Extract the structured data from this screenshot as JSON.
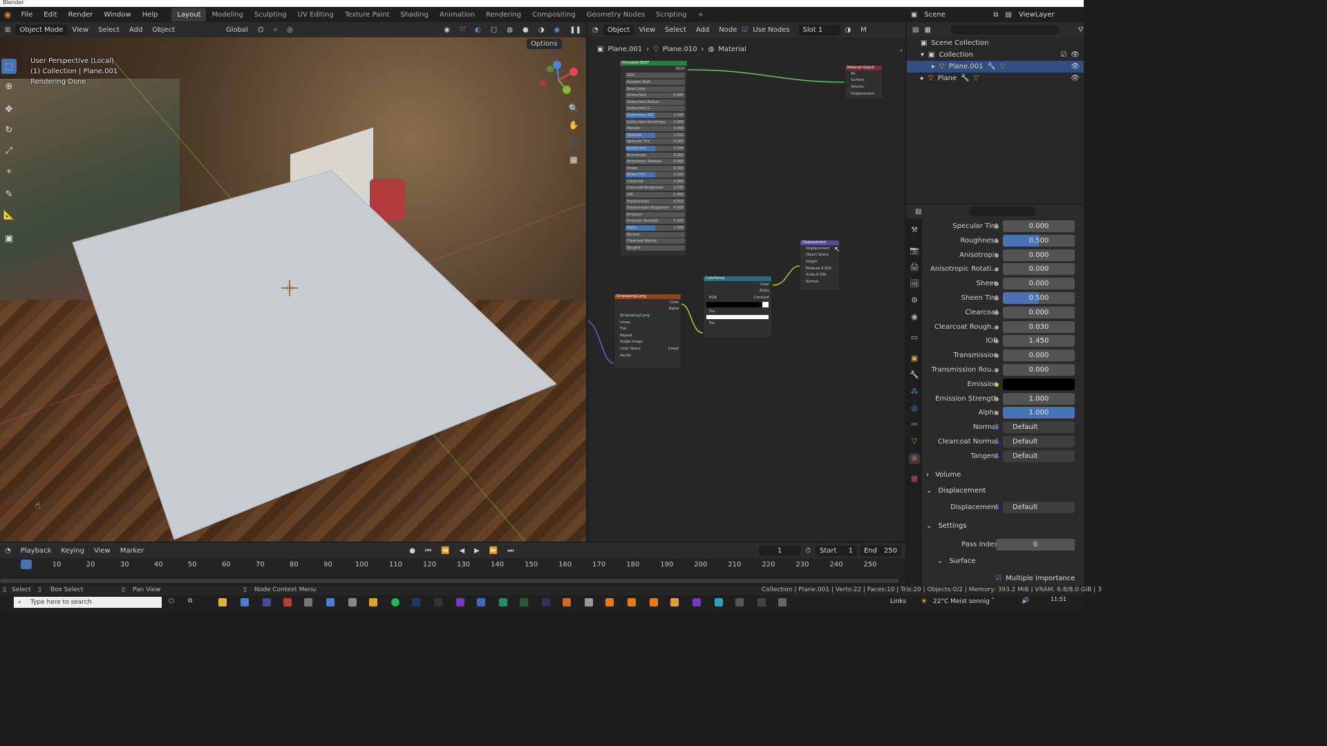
{
  "app_title": "Blender",
  "menu": [
    "File",
    "Edit",
    "Render",
    "Window",
    "Help"
  ],
  "workspaces": [
    "Layout",
    "Modeling",
    "Sculpting",
    "UV Editing",
    "Texture Paint",
    "Shading",
    "Animation",
    "Rendering",
    "Compositing",
    "Geometry Nodes",
    "Scripting"
  ],
  "active_workspace": "Layout",
  "scene": "Scene",
  "view_layer": "ViewLayer",
  "viewport_header": {
    "mode": "Object Mode",
    "menus": [
      "View",
      "Select",
      "Add",
      "Object"
    ],
    "transform": "Global",
    "options": "Options"
  },
  "viewport_info": {
    "line1": "User Perspective (Local)",
    "line2": "(1) Collection | Plane.001",
    "line3": "Rendering Done"
  },
  "node_header": {
    "type": "Object",
    "menus": [
      "View",
      "Select",
      "Add",
      "Node"
    ],
    "use_nodes": "Use Nodes",
    "slot": "Slot 1",
    "extra": "M"
  },
  "breadcrumb": [
    "Plane.001",
    "Plane.010",
    "Material"
  ],
  "nodes": {
    "bsdf": {
      "title": "Principled BSDF",
      "out": "BSDF",
      "rows": [
        {
          "label": "GGX",
          "value": ""
        },
        {
          "label": "Random Walk",
          "value": ""
        },
        {
          "label": "Base Color",
          "value": ""
        },
        {
          "label": "Subsurface",
          "value": "0.000"
        },
        {
          "label": "Subsurface Radius",
          "value": ""
        },
        {
          "label": "Subsurface C...",
          "value": ""
        },
        {
          "label": "Subsurface IOR",
          "value": "1.400"
        },
        {
          "label": "Subsurface Anisotropy",
          "value": "0.000"
        },
        {
          "label": "Metallic",
          "value": "0.000"
        },
        {
          "label": "Specular",
          "value": "0.500"
        },
        {
          "label": "Specular Tint",
          "value": "0.000"
        },
        {
          "label": "Roughness",
          "value": "0.500"
        },
        {
          "label": "Anisotropic",
          "value": "0.000"
        },
        {
          "label": "Anisotropic Rotation",
          "value": "0.000"
        },
        {
          "label": "Sheen",
          "value": "0.000"
        },
        {
          "label": "Sheen Tint",
          "value": "0.500"
        },
        {
          "label": "Clearcoat",
          "value": "0.000"
        },
        {
          "label": "Clearcoat Roughness",
          "value": "0.030"
        },
        {
          "label": "IOR",
          "value": "1.450"
        },
        {
          "label": "Transmission",
          "value": "0.000"
        },
        {
          "label": "Transmission Roughness",
          "value": "0.000"
        },
        {
          "label": "Emission",
          "value": ""
        },
        {
          "label": "Emission Strength",
          "value": "1.000"
        },
        {
          "label": "Alpha",
          "value": "1.000"
        },
        {
          "label": "Normal",
          "value": ""
        },
        {
          "label": "Clearcoat Normal",
          "value": ""
        },
        {
          "label": "Tangent",
          "value": ""
        }
      ]
    },
    "output": {
      "title": "Material Output",
      "rows": [
        "All",
        "Surface",
        "Volume",
        "Displacement"
      ]
    },
    "displacement": {
      "title": "Displacement",
      "rows": [
        "Displacement",
        "Object Space",
        "Height",
        "Midlevel 0.500",
        "Scale 0.100",
        "Normal"
      ]
    },
    "colorramp": {
      "title": "ColorRamp",
      "rows": [
        "Color",
        "Alpha",
        "RGB",
        "Constant",
        "Pos",
        "Fac"
      ]
    },
    "image": {
      "title": "Stripesping2.png",
      "rows": [
        "Color",
        "Alpha",
        "Stripesping2.png",
        "Linear",
        "Flat",
        "Repeat",
        "Single Image",
        "Color Space",
        "Linear",
        "Vector"
      ]
    }
  },
  "outliner": {
    "root": "Scene Collection",
    "collection": "Collection",
    "items": [
      "Plane.001",
      "Plane"
    ]
  },
  "properties": {
    "rows": [
      {
        "label": "Specular Tint",
        "value": "0.000",
        "style": "plain"
      },
      {
        "label": "Roughness",
        "value": "0.500",
        "style": "half"
      },
      {
        "label": "Anisotropic",
        "value": "0.000",
        "style": "plain"
      },
      {
        "label": "Anisotropic Rotati...",
        "value": "0.000",
        "style": "plain"
      },
      {
        "label": "Sheen",
        "value": "0.000",
        "style": "plain"
      },
      {
        "label": "Sheen Tint",
        "value": "0.500",
        "style": "half"
      },
      {
        "label": "Clearcoat",
        "value": "0.000",
        "style": "plain"
      },
      {
        "label": "Clearcoat Rough...",
        "value": "0.030",
        "style": "plain"
      },
      {
        "label": "IOR",
        "value": "1.450",
        "style": "plain"
      },
      {
        "label": "Transmission",
        "value": "0.000",
        "style": "plain"
      },
      {
        "label": "Transmission Rou...",
        "value": "0.000",
        "style": "plain"
      },
      {
        "label": "Emission",
        "value": "",
        "style": "black"
      },
      {
        "label": "Emission Strength",
        "value": "1.000",
        "style": "plain"
      },
      {
        "label": "Alpha",
        "value": "1.000",
        "style": "blue"
      },
      {
        "label": "Normal",
        "value": "Default",
        "style": "link"
      },
      {
        "label": "Clearcoat Normal",
        "value": "Default",
        "style": "link"
      },
      {
        "label": "Tangent",
        "value": "Default",
        "style": "link"
      }
    ],
    "volume": "Volume",
    "displacement_section": "Displacement",
    "displacement_label": "Displacement",
    "displacement_value": "Default",
    "settings": "Settings",
    "pass_index_label": "Pass Index",
    "pass_index_value": "0",
    "surface": "Surface",
    "multiple_importance": "Multiple Importance"
  },
  "timeline": {
    "menus": [
      "Playback",
      "Keying",
      "View",
      "Marker"
    ],
    "current_frame": "1",
    "start_label": "Start",
    "start": "1",
    "end_label": "End",
    "end": "250",
    "ticks": [
      "1",
      "10",
      "20",
      "30",
      "40",
      "50",
      "60",
      "70",
      "80",
      "90",
      "100",
      "110",
      "120",
      "130",
      "140",
      "150",
      "160",
      "170",
      "180",
      "190",
      "200",
      "210",
      "220",
      "230",
      "240",
      "250"
    ]
  },
  "statusbar": {
    "select": "Select",
    "box_select": "Box Select",
    "pan_view": "Pan View",
    "node_context": "Node Context Menu",
    "stats": "Collection | Plane.001 | Verts:22 | Faces:10 | Tris:20 | Objects:0/2 | Memory: 393.2 MiB | VRAM: 6.8/8.0 GiB | 3"
  },
  "taskbar": {
    "search": "Type here to search",
    "links": "Links",
    "weather": "22°C  Meist sonnig",
    "time": "11:51"
  }
}
